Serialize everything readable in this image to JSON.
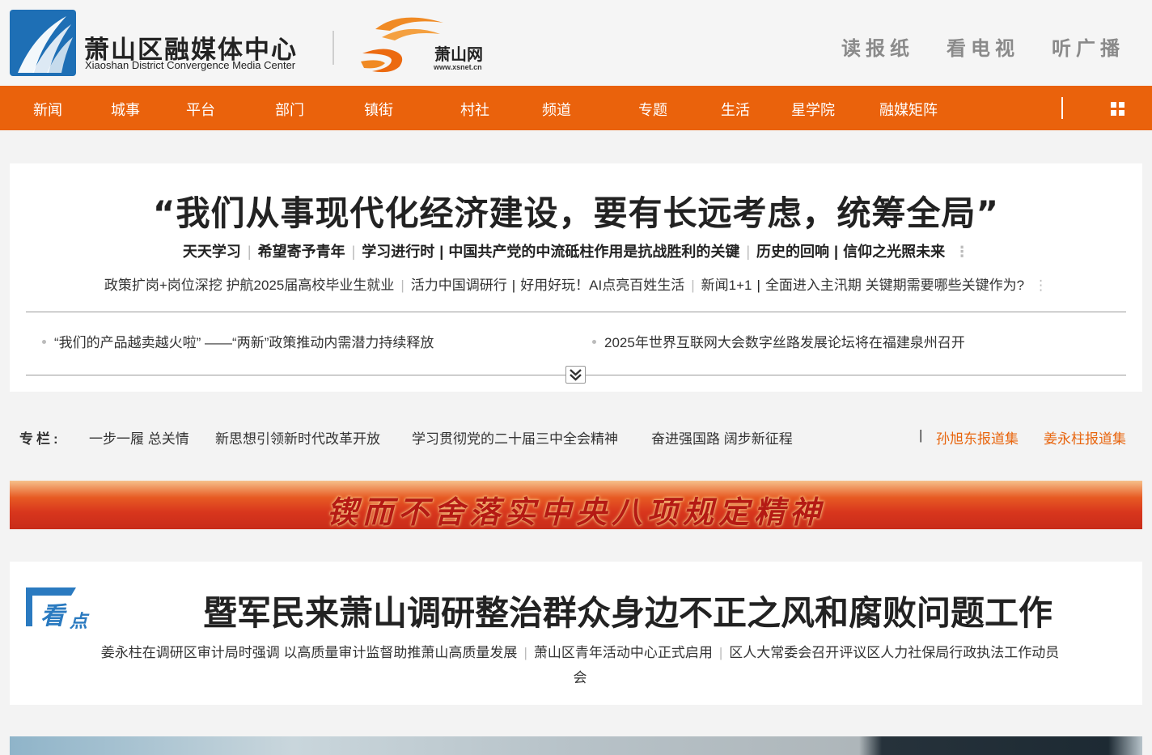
{
  "header": {
    "logo_title": "萧山区融媒体中心",
    "logo_subtitle": "Xiaoshan District Convergence Media Center",
    "partner_name": "萧山网",
    "partner_url": "www.xsnet.cn",
    "top_links": [
      "读报纸",
      "看电视",
      "听广播"
    ]
  },
  "nav": {
    "items": [
      "新闻",
      "城事",
      "平台",
      "部门",
      "镇街",
      "村社",
      "频道",
      "专题",
      "生活",
      "星学院",
      "融媒矩阵"
    ],
    "accent_color": "#ea620c"
  },
  "headline": {
    "title": "“我们从事现代化经济建设，要有长远考虑，统筹全局”",
    "sub1": [
      "天天学习",
      "希望寄予青年",
      "学习进行时",
      "中国共产党的中流砥柱作用是抗战胜利的关键",
      "历史的回响",
      "信仰之光照未来"
    ],
    "sub2": [
      "政策扩岗+岗位深挖 护航2025届高校毕业生就业",
      "活力中国调研行",
      "好用好玩！AI点亮百姓生活",
      "新闻1+1",
      "全面进入主汛期 关键期需要哪些关键作为?"
    ],
    "news_left": "“我们的产品越卖越火啦” ——“两新”政策推动内需潜力持续释放",
    "news_right": "2025年世界互联网大会数字丝路发展论坛将在福建泉州召开"
  },
  "columns": {
    "label": "专栏:",
    "items": [
      "一步一履 总关情",
      "新思想引领新时代改革开放",
      "学习贯彻党的二十届三中全会精神",
      "奋进强国路 阔步新征程"
    ],
    "separator": "|",
    "highlight": [
      "孙旭东报道集",
      "姜永柱报道集"
    ],
    "highlight_color": "#e8650e"
  },
  "banner": {
    "text": "锲而不舍落实中央八项规定精神"
  },
  "kandian": {
    "badge_1": "看",
    "badge_2": "点",
    "title": "暨军民来萧山调研整治群众身边不正之风和腐败问题工作",
    "links": [
      "姜永柱在调研区审计局时强调 以高质量审计监督助推萧山高质量发展",
      "萧山区青年活动中心正式启用",
      "区人大常委会召开评议区人力社保局行政执法工作动员会"
    ]
  }
}
